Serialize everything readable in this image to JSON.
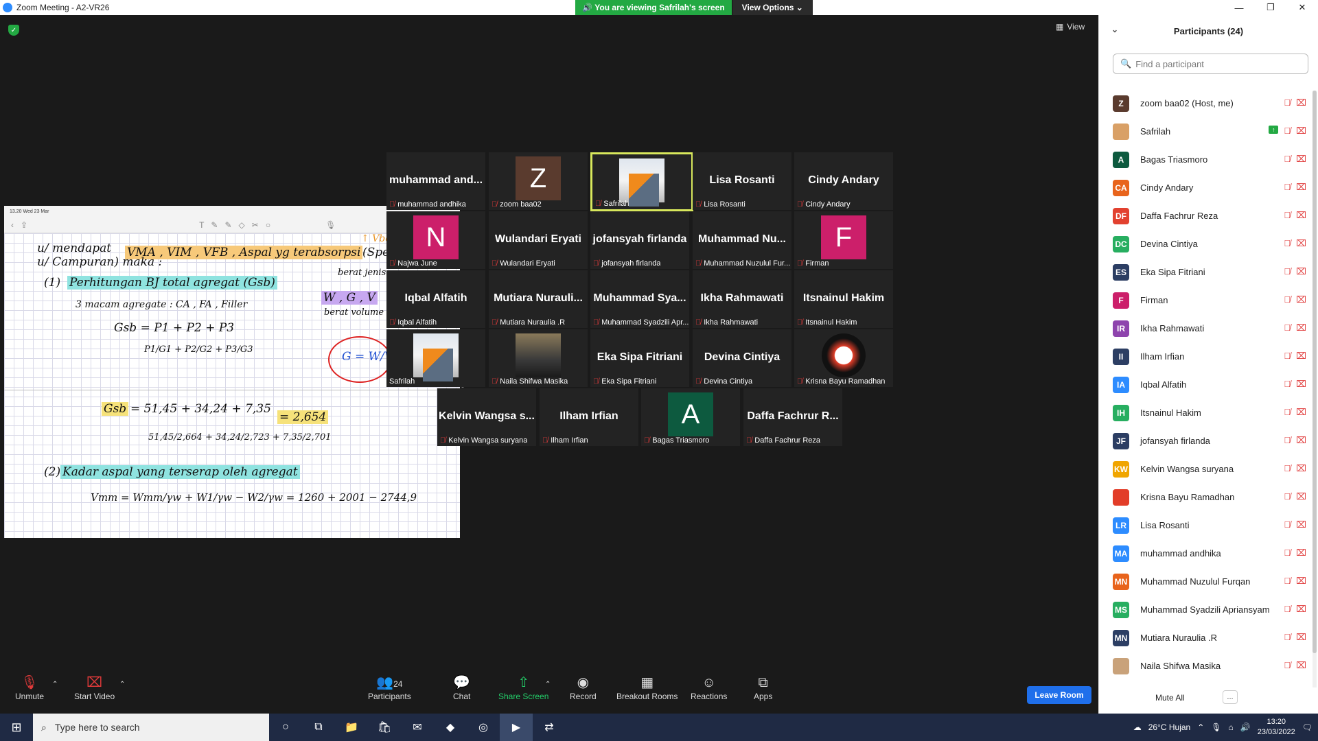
{
  "window": {
    "title": "Zoom Meeting - A2-VR26",
    "minimize": "—",
    "maximize": "❐",
    "close": "✕"
  },
  "banner": {
    "viewing": "You are viewing Safrilah's screen",
    "view_options": "View Options ⌄"
  },
  "meeting": {
    "view_label": "View"
  },
  "shared_screen": {
    "ipad_time": "13.20  Wed 23 Mar",
    "lines": [
      "u/ mendapat",
      "VMA , VIM , VFB , Aspal yg terabsorpsi",
      "(Spek teknis",
      "u/ Campuran)  maka :",
      "(1)",
      "Perhitungan BJ total agregat (Gsb)",
      "3 macam  agregate  :  CA , FA , Filler",
      "Gsb =  P1 + P2 + P3",
      "P1/G1 + P2/G2 + P3/G3",
      "↑ Vbc",
      "berat jenis",
      "W , G , V",
      "berat     volume",
      "G = W/V",
      "Gsb",
      "=   51,45 + 34,24 + 7,35",
      "51,45/2,664 + 34,24/2,723 + 7,35/2,701",
      "= 2,654",
      "(2)",
      "Kadar aspal yang terserap oleh agregat",
      "Vmm =  Wmm/γw + W1/γw − W2/γw  =  1260 + 2001 − 2744,9"
    ]
  },
  "gallery": [
    {
      "big": "muhammad  and...",
      "label": "muhammad andhika",
      "type": "name"
    },
    {
      "avatar": "Z",
      "color": "#5a3b2e",
      "label": "zoom baa02",
      "type": "letter"
    },
    {
      "label": "Safrilah",
      "type": "building",
      "active": true
    },
    {
      "big": "Lisa Rosanti",
      "label": "Lisa Rosanti",
      "type": "name"
    },
    {
      "big": "Cindy Andary",
      "label": "Cindy Andary",
      "type": "name"
    },
    {
      "avatar": "N",
      "color": "#cc1f6a",
      "label": "Najwa June",
      "type": "letter"
    },
    {
      "big": "Wulandari Eryati",
      "label": "Wulandari Eryati",
      "type": "name"
    },
    {
      "big": "jofansyah firlanda",
      "label": "jofansyah firlanda",
      "type": "name"
    },
    {
      "big": "Muhammad  Nu...",
      "label": "Muhammad Nuzulul Fur...",
      "type": "name"
    },
    {
      "avatar": "F",
      "color": "#cc1f6a",
      "label": "Firman",
      "type": "letter"
    },
    {
      "big": "Iqbal Alfatih",
      "label": "Iqbal Alfatih",
      "type": "name"
    },
    {
      "big": "Mutiara  Nurauli...",
      "label": "Mutiara Nuraulia .R",
      "type": "name"
    },
    {
      "big": "Muhammad  Sya...",
      "label": "Muhammad Syadzili Apr...",
      "type": "name"
    },
    {
      "big": "Ikha Rahmawati",
      "label": "Ikha Rahmawati",
      "type": "name"
    },
    {
      "big": "Itsnainul Hakim",
      "label": "Itsnainul Hakim",
      "type": "name"
    },
    {
      "label": "Safrilah",
      "type": "building"
    },
    {
      "label": "Naila Shifwa Masika",
      "type": "naila"
    },
    {
      "big": "Eka Sipa Fitriani",
      "label": "Eka Sipa Fitriani",
      "type": "name"
    },
    {
      "big": "Devina Cintiya",
      "label": "Devina Cintiya",
      "type": "name"
    },
    {
      "label": "Krisna Bayu Ramadhan",
      "type": "krisna"
    },
    {
      "big": "Kelvin  Wangsa  s...",
      "label": "Kelvin Wangsa suryana",
      "type": "name"
    },
    {
      "big": "Ilham Irfian",
      "label": "Ilham Irfian",
      "type": "name"
    },
    {
      "avatar": "A",
      "color": "#0d5a3f",
      "label": "Bagas Triasmoro",
      "type": "letter"
    },
    {
      "big": "Daffa Fachrur R...",
      "label": "Daffa Fachrur Reza",
      "type": "name"
    }
  ],
  "participants": {
    "title": "Participants (24)",
    "search_placeholder": "Find a participant",
    "list": [
      {
        "initials": "Z",
        "color": "#5a3b2e",
        "name": "zoom baa02 (Host, me)"
      },
      {
        "initials": "",
        "color": "#d9a066",
        "name": "Safrilah",
        "sharing": true
      },
      {
        "initials": "A",
        "color": "#0d5a3f",
        "name": "Bagas Triasmoro"
      },
      {
        "initials": "CA",
        "color": "#e8641c",
        "name": "Cindy Andary"
      },
      {
        "initials": "DF",
        "color": "#e2412f",
        "name": "Daffa Fachrur Reza"
      },
      {
        "initials": "DC",
        "color": "#27ae60",
        "name": "Devina Cintiya"
      },
      {
        "initials": "ES",
        "color": "#2c3e63",
        "name": "Eka Sipa Fitriani"
      },
      {
        "initials": "F",
        "color": "#cc1f6a",
        "name": "Firman"
      },
      {
        "initials": "IR",
        "color": "#8e44ad",
        "name": "Ikha Rahmawati"
      },
      {
        "initials": "II",
        "color": "#2c3e63",
        "name": "Ilham Irfian"
      },
      {
        "initials": "IA",
        "color": "#2d8cff",
        "name": "Iqbal Alfatih"
      },
      {
        "initials": "IH",
        "color": "#27ae60",
        "name": "Itsnainul Hakim"
      },
      {
        "initials": "JF",
        "color": "#2c3e63",
        "name": "jofansyah firlanda"
      },
      {
        "initials": "KW",
        "color": "#f0a500",
        "name": "Kelvin Wangsa suryana"
      },
      {
        "initials": "",
        "color": "#e23d28",
        "name": "Krisna Bayu Ramadhan"
      },
      {
        "initials": "LR",
        "color": "#2d8cff",
        "name": "Lisa Rosanti"
      },
      {
        "initials": "MA",
        "color": "#2d8cff",
        "name": "muhammad andhika"
      },
      {
        "initials": "MN",
        "color": "#e8641c",
        "name": "Muhammad Nuzulul Furqan"
      },
      {
        "initials": "MS",
        "color": "#27ae60",
        "name": "Muhammad Syadzili Apriansyam"
      },
      {
        "initials": "MN",
        "color": "#2c3e63",
        "name": "Mutiara Nuraulia .R"
      },
      {
        "initials": "",
        "color": "#c9a27a",
        "name": "Naila Shifwa Masika"
      }
    ],
    "mute_all": "Mute All",
    "more": "..."
  },
  "toolbar": {
    "unmute": "Unmute",
    "start_video": "Start Video",
    "participants": "Participants",
    "participants_count": "24",
    "chat": "Chat",
    "share_screen": "Share Screen",
    "record": "Record",
    "breakout": "Breakout Rooms",
    "reactions": "Reactions",
    "apps": "Apps",
    "leave": "Leave Room"
  },
  "taskbar": {
    "search_placeholder": "Type here to search",
    "weather": "26°C  Hujan",
    "time": "13:20",
    "date": "23/03/2022"
  }
}
